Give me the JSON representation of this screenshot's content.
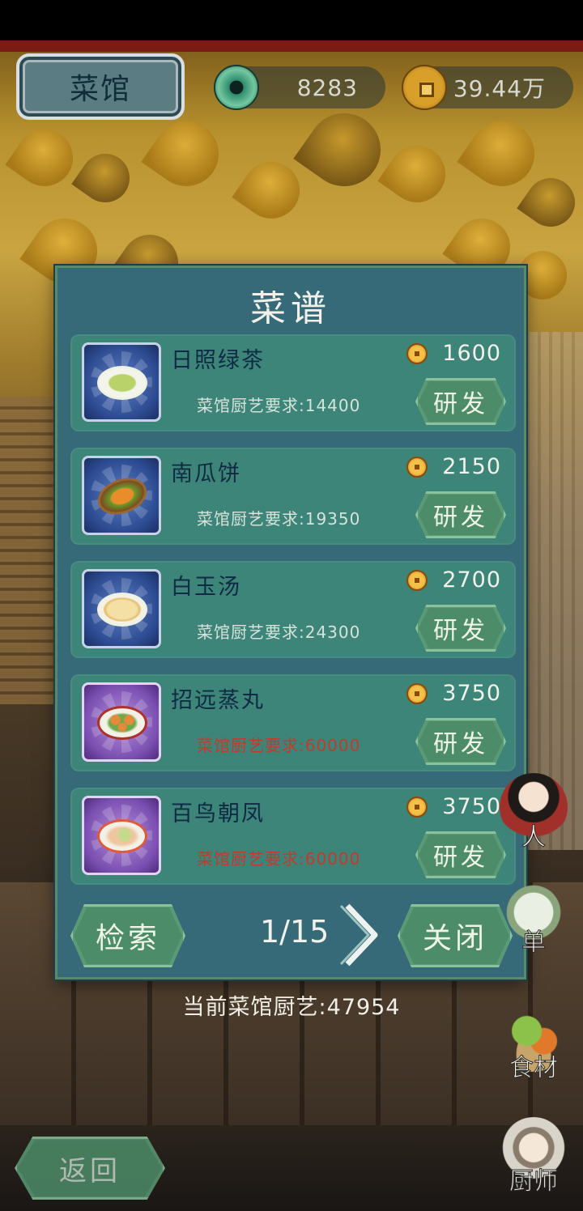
{
  "hud": {
    "location_label": "菜馆",
    "jade_value": "8283",
    "coin_value": "39.44万"
  },
  "panel": {
    "title": "菜谱",
    "recipes": [
      {
        "name": "日照绿茶",
        "cost": "1600",
        "requirement": "菜馆厨艺要求:14400",
        "button": "研发",
        "frame": "blue",
        "dish_icon": "tea-dish-icon",
        "meets_requirement": true
      },
      {
        "name": "南瓜饼",
        "cost": "2150",
        "requirement": "菜馆厨艺要求:19350",
        "button": "研发",
        "frame": "blue",
        "dish_icon": "pumpkin-cake-dish-icon",
        "meets_requirement": true
      },
      {
        "name": "白玉汤",
        "cost": "2700",
        "requirement": "菜馆厨艺要求:24300",
        "button": "研发",
        "frame": "blue",
        "dish_icon": "soup-dish-icon",
        "meets_requirement": true
      },
      {
        "name": "招远蒸丸",
        "cost": "3750",
        "requirement": "菜馆厨艺要求:60000",
        "button": "研发",
        "frame": "purple",
        "dish_icon": "steamed-meatball-dish-icon",
        "meets_requirement": false
      },
      {
        "name": "百鸟朝凤",
        "cost": "3750",
        "requirement": "菜馆厨艺要求:60000",
        "button": "研发",
        "frame": "purple",
        "dish_icon": "phoenix-dish-icon",
        "meets_requirement": false
      }
    ],
    "search_label": "检索",
    "page_indicator": "1/15",
    "close_label": "关闭"
  },
  "skill_total": "当前菜馆厨艺:47954",
  "side_menu": [
    {
      "label": "人",
      "icon": "lady-portrait-icon"
    },
    {
      "label": "单",
      "icon": "menu-dishes-icon"
    },
    {
      "label": "食材",
      "icon": "ingredients-basket-icon"
    },
    {
      "label": "厨师",
      "icon": "chef-portrait-icon"
    }
  ],
  "back_label": "返回",
  "colors": {
    "panel_bg": "#366a78",
    "row_bg": "#3c8578",
    "button_green": "#4d8c69",
    "locked_requirement": "#c23a2c",
    "recipe_name": "#0f2a44"
  }
}
